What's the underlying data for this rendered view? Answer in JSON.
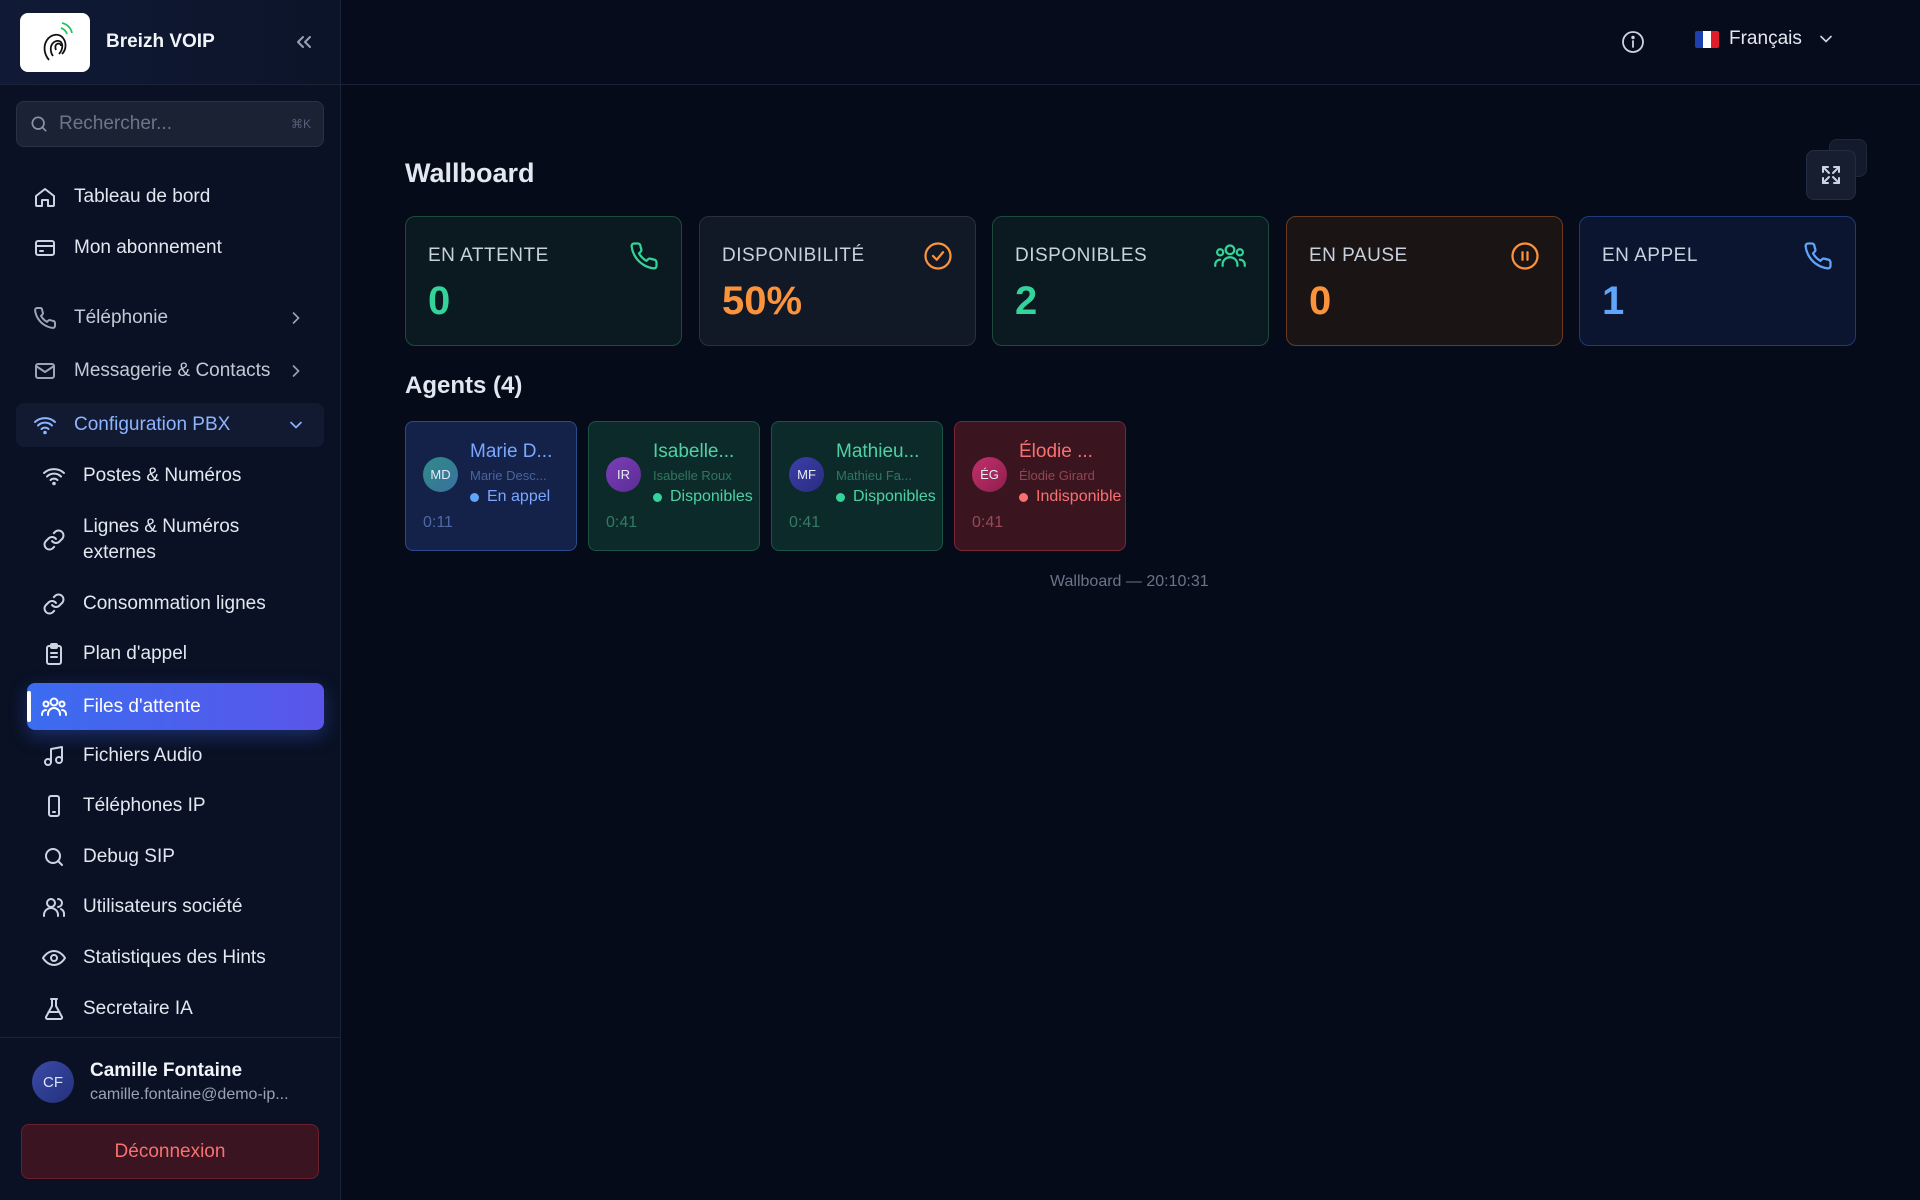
{
  "brand": {
    "name": "Breizh VOIP"
  },
  "search": {
    "placeholder": "Rechercher...",
    "shortcut": "⌘K"
  },
  "nav": {
    "top_items": [
      {
        "label": "Tableau de bord",
        "icon": "home-icon"
      },
      {
        "label": "Mon abonnement",
        "icon": "credit-card-icon"
      }
    ],
    "groups": [
      {
        "label": "Téléphonie",
        "icon": "phone-icon",
        "state": "collapsed"
      },
      {
        "label": "Messagerie & Contacts",
        "icon": "mail-icon",
        "state": "collapsed"
      },
      {
        "label": "Configuration PBX",
        "icon": "wifi-icon",
        "state": "expanded"
      }
    ],
    "pbx_items": [
      {
        "label": "Postes & Numéros",
        "icon": "wifi-icon"
      },
      {
        "label": "Lignes & Numéros externes",
        "icon": "link-icon"
      },
      {
        "label": "Consommation lignes",
        "icon": "link-icon"
      },
      {
        "label": "Plan d'appel",
        "icon": "clipboard-icon"
      },
      {
        "label": "Files d'attente",
        "icon": "users-icon",
        "active": true
      },
      {
        "label": "Fichiers Audio",
        "icon": "music-icon"
      },
      {
        "label": "Téléphones IP",
        "icon": "smartphone-icon"
      },
      {
        "label": "Debug SIP",
        "icon": "search-icon"
      },
      {
        "label": "Utilisateurs société",
        "icon": "user-group-icon"
      },
      {
        "label": "Statistiques des Hints",
        "icon": "eye-icon"
      },
      {
        "label": "Secretaire IA",
        "icon": "flask-icon"
      }
    ]
  },
  "user": {
    "initials": "CF",
    "name": "Camille Fontaine",
    "email": "camille.fontaine@demo-ip...",
    "logout_label": "Déconnexion"
  },
  "topbar": {
    "language": "Français"
  },
  "page": {
    "title": "Wallboard"
  },
  "stats": [
    {
      "label": "EN ATTENTE",
      "value": "0",
      "icon": "phone-icon"
    },
    {
      "label": "DISPONIBILITÉ",
      "value": "50%",
      "icon": "check-circle-icon"
    },
    {
      "label": "DISPONIBLES",
      "value": "2",
      "icon": "users-icon"
    },
    {
      "label": "EN PAUSE",
      "value": "0",
      "icon": "pause-circle-icon"
    },
    {
      "label": "EN APPEL",
      "value": "1",
      "icon": "phone-icon"
    }
  ],
  "agents_title": "Agents (4)",
  "agents": [
    {
      "initials": "MD",
      "short": "Marie D...",
      "full": "Marie Desc...",
      "status": "En appel",
      "time": "0:11"
    },
    {
      "initials": "IR",
      "short": "Isabelle...",
      "full": "Isabelle Roux",
      "status": "Disponibles",
      "time": "0:41"
    },
    {
      "initials": "MF",
      "short": "Mathieu...",
      "full": "Mathieu Fa...",
      "status": "Disponibles",
      "time": "0:41"
    },
    {
      "initials": "ÉG",
      "short": "Élodie ...",
      "full": "Élodie Girard",
      "status": "Indisponible",
      "time": "0:41"
    }
  ],
  "footer_stamp": "Wallboard — 20:10:31",
  "colors": {
    "accent": "#3b6cf0",
    "available": "#34d399",
    "paused": "#fb923c",
    "in_call": "#60a5fa",
    "unavailable": "#f87171"
  }
}
